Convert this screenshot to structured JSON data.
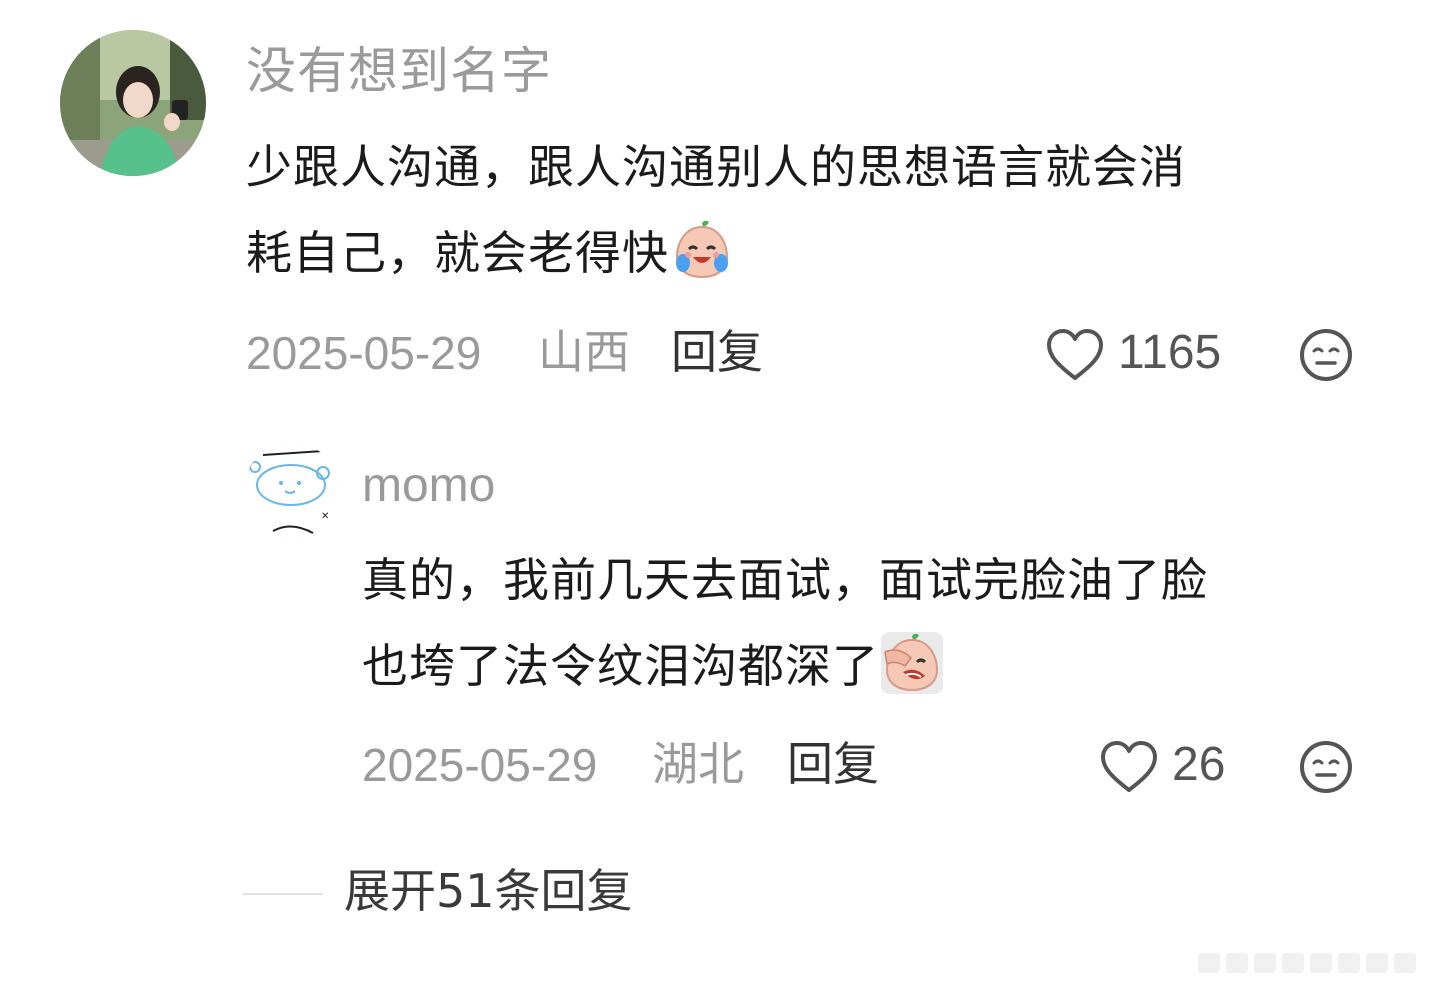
{
  "comment": {
    "username": "没有想到名字",
    "text_lines": [
      "少跟人沟通，跟人沟通别人的思想语言就会消",
      "耗自己，就会老得快"
    ],
    "emoji": "crying-laughing-emoji",
    "date": "2025-05-29",
    "location": "山西",
    "reply_label": "回复",
    "like_count": "1165",
    "icons": {
      "like": "heart-icon",
      "dislike": "neutral-face-icon"
    }
  },
  "reply": {
    "username": "momo",
    "text_lines": [
      "真的，我前几天去面试，面试完脸油了脸",
      "也垮了法令纹泪沟都深了"
    ],
    "emoji": "facepalm-crying-emoji",
    "date": "2025-05-29",
    "location": "湖北",
    "reply_label": "回复",
    "like_count": "26",
    "icons": {
      "like": "heart-icon",
      "dislike": "neutral-face-icon"
    }
  },
  "expand_replies": "展开51条回复",
  "colors": {
    "username": "#9a9a9a",
    "text": "#1b1b1b",
    "meta": "#9a9a9a",
    "action": "#333333"
  }
}
